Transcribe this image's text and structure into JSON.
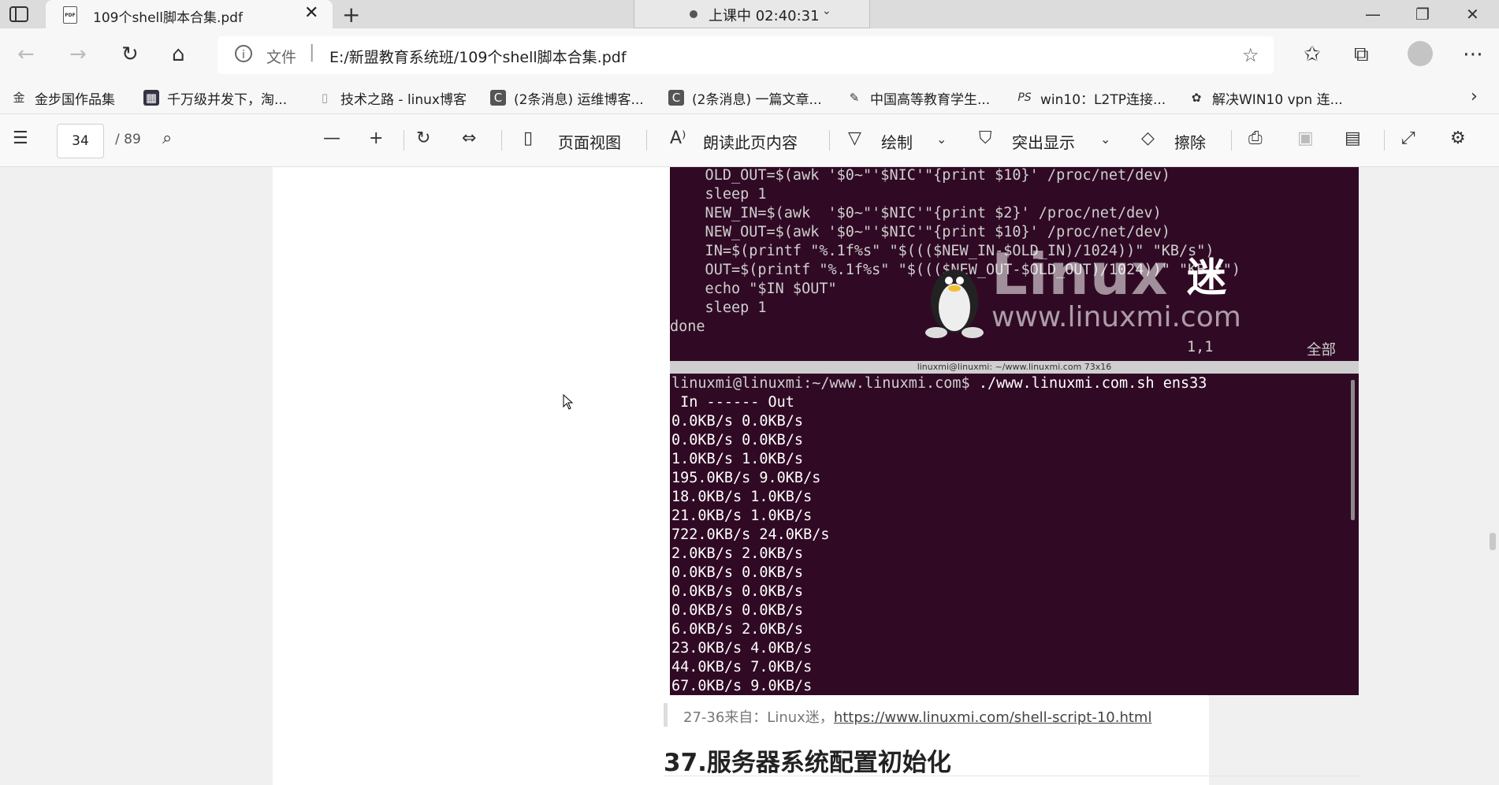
{
  "browser": {
    "tab_title": "109个shell脚本合集.pdf",
    "recording": "上课中 02:40:31",
    "address_prefix": "文件",
    "url": "E:/新盟教育系统班/109个shell脚本合集.pdf"
  },
  "bookmarks": [
    {
      "label": "金步国作品集",
      "icon": "金"
    },
    {
      "label": "千万级并发下，淘...",
      "icon": "▦"
    },
    {
      "label": "技术之路 - linux博客",
      "icon": "▯"
    },
    {
      "label": "(2条消息) 运维博客...",
      "icon": "C"
    },
    {
      "label": "(2条消息) 一篇文章...",
      "icon": "C"
    },
    {
      "label": "中国高等教育学生...",
      "icon": "✎"
    },
    {
      "label": "win10：L2TP连接...",
      "icon": "PS"
    },
    {
      "label": "解决WIN10 vpn 连...",
      "icon": "✿"
    }
  ],
  "pdf_toolbar": {
    "page_current": "34",
    "page_total": "/ 89",
    "page_view": "页面视图",
    "read_aloud": "朗读此页内容",
    "draw": "绘制",
    "highlight": "突出显示",
    "erase": "擦除"
  },
  "vim": {
    "lines": [
      "    OLD_OUT=$(awk '$0~\"'$NIC'\"{print $10}' /proc/net/dev)",
      "    sleep 1",
      "    NEW_IN=$(awk  '$0~\"'$NIC'\"{print $2}' /proc/net/dev)",
      "    NEW_OUT=$(awk '$0~\"'$NIC'\"{print $10}' /proc/net/dev)",
      "    IN=$(printf \"%.1f%s\" \"$((($NEW_IN-$OLD_IN)/1024))\" \"KB/s\")",
      "    OUT=$(printf \"%.1f%s\" \"$((($NEW_OUT-$OLD_OUT)/1024))\" \"KB/s\")",
      "    echo \"$IN $OUT\"",
      "    sleep 1",
      "done"
    ],
    "position": "1,1",
    "scroll_label": "全部"
  },
  "terminal": {
    "title_bar": "linuxmi@linuxmi: ~/www.linuxmi.com 73x16",
    "prompt": "linuxmi@linuxmi:~/www.linuxmi.com$",
    "command": " ./www.linuxmi.com.sh ens33",
    "header": " In ------ Out",
    "rows": [
      "0.0KB/s 0.0KB/s",
      "0.0KB/s 0.0KB/s",
      "1.0KB/s 1.0KB/s",
      "195.0KB/s 9.0KB/s",
      "18.0KB/s 1.0KB/s",
      "21.0KB/s 1.0KB/s",
      "722.0KB/s 24.0KB/s",
      "2.0KB/s 2.0KB/s",
      "0.0KB/s 0.0KB/s",
      "0.0KB/s 0.0KB/s",
      "0.0KB/s 0.0KB/s",
      "6.0KB/s 2.0KB/s",
      "23.0KB/s 4.0KB/s",
      "44.0KB/s 7.0KB/s",
      "67.0KB/s 9.0KB/s"
    ]
  },
  "watermark": {
    "brand": "Linux",
    "mi": "迷",
    "site": "www.linuxmi.com"
  },
  "document": {
    "caption_prefix": "27-36来自：Linux迷，",
    "caption_link": "https://www.linuxmi.com/shell-script-10.html",
    "heading": "37.服务器系统配置初始化"
  }
}
